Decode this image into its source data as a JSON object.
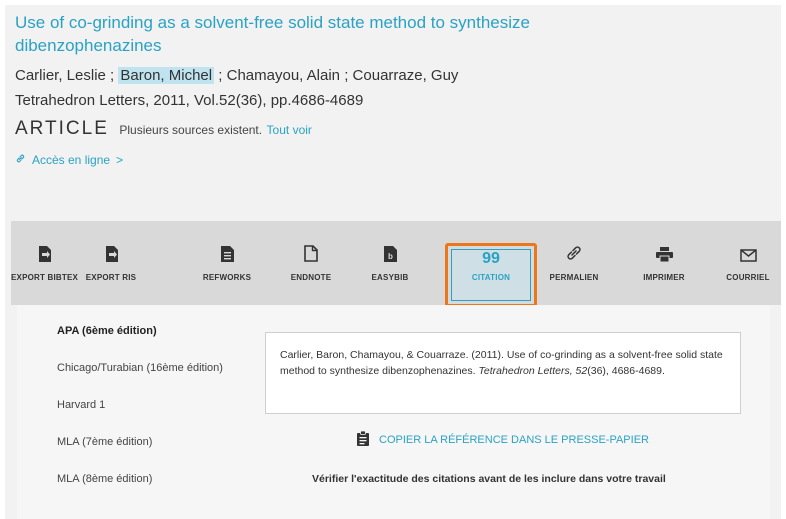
{
  "record": {
    "title_line1": "Use of co-grinding as a solvent-free solid state method to synthesize",
    "title_line2": "dibenzophenazines",
    "author1": "Carlier, Leslie",
    "sep1": " ; ",
    "author2": "Baron, Michel",
    "sep2": " ; ",
    "author3": "Chamayou, Alain",
    "sep3": " ; ",
    "author4": "Couarraze, Guy",
    "journal": "Tetrahedron Letters, 2011, Vol.52(36), pp.4686-4689",
    "type": "Article",
    "sources_text": "Plusieurs sources existent.",
    "see_all": "Tout voir",
    "online_access": "Accès en ligne",
    "online_access_chevron": ">"
  },
  "toolbar": {
    "items": [
      {
        "label": "Export BibTeX",
        "icon": "file-export-icon"
      },
      {
        "label": "Export RIS",
        "icon": "file-export-icon"
      },
      {
        "label": "RefWorks",
        "icon": "file-text-icon"
      },
      {
        "label": "EndNote",
        "icon": "file-bookmark-icon"
      },
      {
        "label": "EasyBib",
        "icon": "file-b-icon"
      },
      {
        "label": "Citation",
        "icon": "quote-icon",
        "active": true
      },
      {
        "label": "Permalien",
        "icon": "link-icon"
      },
      {
        "label": "Imprimer",
        "icon": "printer-icon"
      },
      {
        "label": "Courriel",
        "icon": "envelope-icon"
      }
    ],
    "quote_glyph": "99",
    "active_color": "#e8771d",
    "accent_color": "#2aa2c3"
  },
  "citation": {
    "styles": [
      "APA (6ème édition)",
      "Chicago/Turabian (16ème édition)",
      "Harvard 1",
      "MLA (7ème édition)",
      "MLA (8ème édition)"
    ],
    "selected_style": "APA (6ème édition)",
    "text_part1": "Carlier, Baron, Chamayou, & Couarraze. (2011). Use of co-grinding as a solvent-free solid state method to synthesize dibenzophenazines. ",
    "text_journal": "Tetrahedron Letters, 52",
    "text_part2": "(36), 4686-4689.",
    "copy_label": "COPIER LA RÉFÉRENCE DANS LE PRESSE-PAPIER",
    "verify_note": "Vérifier l'exactitude des citations avant de les inclure dans votre travail"
  }
}
